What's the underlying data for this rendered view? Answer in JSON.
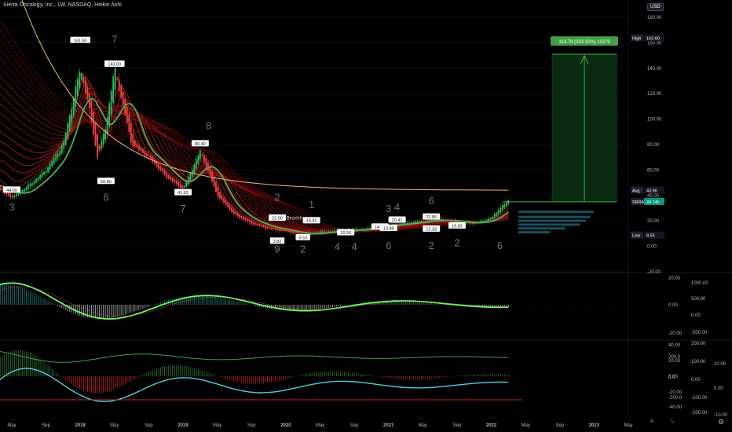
{
  "header": {
    "title": "Sierra Oncology, Inc., 1W, NASDAQ, Heikin Ashi",
    "currency": "USD"
  },
  "price_axis": {
    "ticks": [
      "180.00",
      "160.00",
      "140.00",
      "120.00",
      "100.00",
      "80.00",
      "60.00",
      "40.00",
      "20.00",
      "0.00",
      "-20.00"
    ]
  },
  "price_labels": {
    "high": {
      "label": "High",
      "value": "163.60"
    },
    "avg": {
      "label": "Avg",
      "value": "43.96"
    },
    "symbol": {
      "label": "SRRA",
      "value": "2d 14h"
    },
    "low": {
      "label": "Low",
      "value": "8.55"
    }
  },
  "measure_box": "113.79 (333.32%) 11379",
  "time_axis": [
    "May",
    "Sep",
    "2018",
    "May",
    "Sep",
    "2019",
    "May",
    "Sep",
    "2020",
    "May",
    "Sep",
    "2021",
    "May",
    "Sep",
    "2022",
    "May",
    "Sep",
    "2023",
    "May"
  ],
  "bottom_controls": {
    "auto": "A",
    "log": "L"
  },
  "panel2_axes": {
    "left": [
      "20.00",
      "0.00",
      "-20.00"
    ],
    "right": [
      "1000.00",
      "500.00",
      "0.00",
      "-500.00"
    ]
  },
  "panel3_axes": {
    "left": [
      "40.00",
      "20.00",
      "0.00",
      "-20.00",
      "-40.00"
    ],
    "mid": [
      "200.0",
      "0.0",
      "-200.0"
    ],
    "right": [
      "200.00",
      "100.00",
      "0.00",
      "-100.00",
      "-200.00"
    ],
    "far": [
      "10.00",
      "0.00",
      "-10.00"
    ]
  },
  "annotations": {
    "price_flags": [
      {
        "text": "161.60",
        "x": "2018-01",
        "y": 161.6
      },
      {
        "text": "143.00",
        "x": "2018-05",
        "y": 143.0
      },
      {
        "text": "80.40",
        "x": "2019-03",
        "y": 80.4
      },
      {
        "text": "50.80",
        "x": "2018-04",
        "y": 50.8
      },
      {
        "text": "44.00",
        "x": "2017-05",
        "y": 44.0
      },
      {
        "text": "41.93",
        "x": "2019-01",
        "y": 41.93
      },
      {
        "text": "22.00",
        "x": "2019-12",
        "y": 22.0
      },
      {
        "text": "19.91",
        "x": "2020-04",
        "y": 19.91
      },
      {
        "text": "14.92",
        "x": "2020-12",
        "y": 14.92
      },
      {
        "text": "20.41",
        "x": "2021-02",
        "y": 20.41
      },
      {
        "text": "22.85",
        "x": "2021-06",
        "y": 22.85
      },
      {
        "text": "3.82",
        "x": "2019-12",
        "y": 3.82
      },
      {
        "text": "6.53",
        "x": "2020-03",
        "y": 6.53
      },
      {
        "text": "10.50",
        "x": "2020-08",
        "y": 10.5
      },
      {
        "text": "13.88",
        "x": "2021-01",
        "y": 13.88
      },
      {
        "text": "13.33",
        "x": "2021-06",
        "y": 13.33
      },
      {
        "text": "15.83",
        "x": "2021-09",
        "y": 15.83
      }
    ],
    "wave_counts": [
      {
        "text": "3",
        "x": "2017-05",
        "y": 28
      },
      {
        "text": "7",
        "x": "2018-05",
        "y": 160
      },
      {
        "text": "6",
        "x": "2018-04",
        "y": 36
      },
      {
        "text": "8",
        "x": "2019-04",
        "y": 92
      },
      {
        "text": "7",
        "x": "2019-01",
        "y": 27
      },
      {
        "text": "2",
        "x": "2019-12",
        "y": 36
      },
      {
        "text": "9",
        "x": "2019-12",
        "y": -5
      },
      {
        "text": "1",
        "x": "2020-04",
        "y": 30
      },
      {
        "text": "2",
        "x": "2020-03",
        "y": -5
      },
      {
        "text": "4",
        "x": "2020-07",
        "y": -3
      },
      {
        "text": "4",
        "x": "2020-09",
        "y": -3
      },
      {
        "text": "3",
        "x": "2021-01",
        "y": 27
      },
      {
        "text": "4",
        "x": "2021-02",
        "y": 28
      },
      {
        "text": "6",
        "x": "2021-01",
        "y": -2
      },
      {
        "text": "6",
        "x": "2021-06",
        "y": 33
      },
      {
        "text": "2",
        "x": "2021-06",
        "y": -2
      },
      {
        "text": "2",
        "x": "2021-09",
        "y": 0
      },
      {
        "text": "6",
        "x": "2022-02",
        "y": -2
      }
    ],
    "bearish_label": "Bearish"
  },
  "chart_data": [
    {
      "type": "line",
      "title": "Sierra Oncology, Inc., 1W, NASDAQ, Heikin Ashi",
      "ylim": [
        -20,
        180
      ],
      "x": [
        "2017-03",
        "2017-05",
        "2017-07",
        "2017-09",
        "2017-11",
        "2018-01",
        "2018-02",
        "2018-03",
        "2018-04",
        "2018-05",
        "2018-06",
        "2018-07",
        "2018-09",
        "2018-11",
        "2019-01",
        "2019-03",
        "2019-05",
        "2019-07",
        "2019-09",
        "2019-11",
        "2020-01",
        "2020-03",
        "2020-05",
        "2020-07",
        "2020-09",
        "2020-11",
        "2021-01",
        "2021-03",
        "2021-05",
        "2021-07",
        "2021-09",
        "2021-11",
        "2022-01",
        "2022-02",
        "2022-03"
      ],
      "series": [
        {
          "values": [
            48,
            38,
            48,
            60,
            80,
            140,
            110,
            70,
            95,
            140,
            110,
            80,
            70,
            55,
            45,
            75,
            40,
            25,
            18,
            14,
            12,
            9,
            11,
            12,
            13,
            14,
            17,
            18,
            20,
            21,
            19,
            18,
            22,
            30,
            36
          ]
        }
      ]
    }
  ]
}
